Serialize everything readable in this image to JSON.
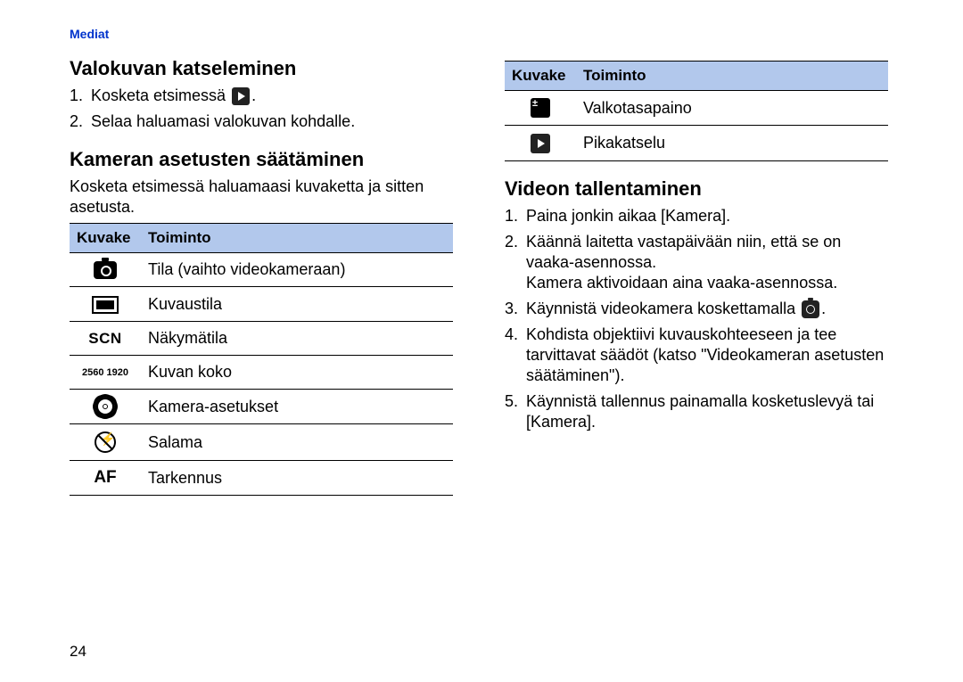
{
  "header": "Mediat",
  "page_number": "24",
  "left": {
    "h_view": "Valokuvan katseleminen",
    "view_steps": [
      {
        "num": "1.",
        "pre": "Kosketa etsimessä ",
        "icon": "play",
        "post": "."
      },
      {
        "num": "2.",
        "pre": "Selaa haluamasi valokuvan kohdalle.",
        "icon": null,
        "post": ""
      }
    ],
    "h_settings": "Kameran asetusten säätäminen",
    "settings_para": "Kosketa etsimessä haluamaasi kuvaketta ja sitten asetusta.",
    "table": {
      "hdr_icon": "Kuvake",
      "hdr_func": "Toiminto",
      "rows": [
        {
          "icon": "camera-solid",
          "text": "Tila (vaihto videokameraan)"
        },
        {
          "icon": "rect-fill",
          "text": "Kuvaustila"
        },
        {
          "icon": "scn",
          "label": "SCN",
          "text": "Näkymätila"
        },
        {
          "icon": "size",
          "label": "2560\n1920",
          "text": "Kuvan koko"
        },
        {
          "icon": "gear",
          "text": "Kamera-asetukset"
        },
        {
          "icon": "noflash",
          "text": "Salama"
        },
        {
          "icon": "af",
          "label": "AF",
          "text": "Tarkennus"
        }
      ]
    }
  },
  "right": {
    "table": {
      "hdr_icon": "Kuvake",
      "hdr_func": "Toiminto",
      "rows": [
        {
          "icon": "ev",
          "label": "±",
          "text": "Valkotasapaino"
        },
        {
          "icon": "play-small",
          "text": "Pikakatselu"
        }
      ]
    },
    "h_video": "Videon tallentaminen",
    "video_steps": [
      {
        "num": "1.",
        "lines": [
          "Paina jonkin aikaa [Kamera]."
        ]
      },
      {
        "num": "2.",
        "lines": [
          "Käännä laitetta vastapäivään niin, että se on vaaka-asennossa.",
          "Kamera aktivoidaan aina vaaka-asennossa."
        ]
      },
      {
        "num": "3.",
        "lines_pre": "Käynnistä videokamera koskettamalla ",
        "icon": "camera",
        "lines_post": "."
      },
      {
        "num": "4.",
        "lines": [
          "Kohdista objektiivi kuvauskohteeseen ja tee tarvittavat säädöt (katso \"Videokameran asetusten säätäminen\")."
        ]
      },
      {
        "num": "5.",
        "lines": [
          "Käynnistä tallennus painamalla kosketuslevyä tai [Kamera]."
        ]
      }
    ]
  }
}
